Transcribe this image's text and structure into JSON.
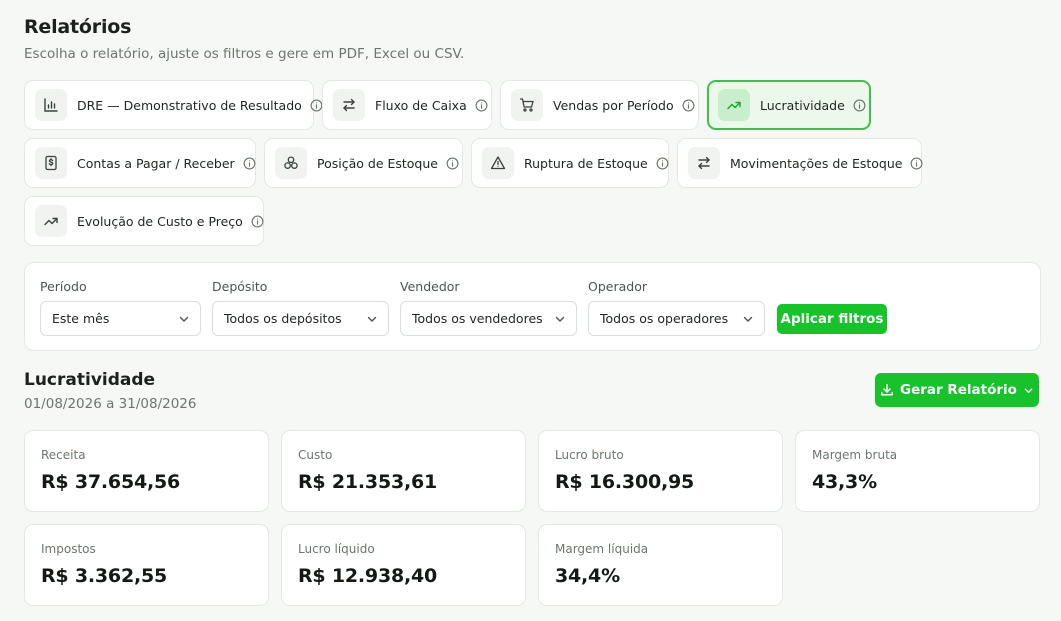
{
  "header": {
    "title": "Relatórios",
    "subtitle": "Escolha o relatório, ajuste os filtros e gere em PDF, Excel ou CSV."
  },
  "reports": [
    {
      "label": "DRE — Demonstrativo de Resultado",
      "icon": "bar-chart-icon"
    },
    {
      "label": "Fluxo de Caixa",
      "icon": "arrows-exchange-icon"
    },
    {
      "label": "Vendas por Período",
      "icon": "shopping-cart-icon"
    },
    {
      "label": "Lucratividade",
      "icon": "trending-up-icon",
      "active": true
    },
    {
      "label": "Contas a Pagar / Receber",
      "icon": "dollar-document-icon"
    },
    {
      "label": "Posição de Estoque",
      "icon": "boxes-icon"
    },
    {
      "label": "Ruptura de Estoque",
      "icon": "warning-triangle-icon"
    },
    {
      "label": "Movimentações de Estoque",
      "icon": "arrows-exchange-icon"
    },
    {
      "label": "Evolução de Custo e Preço",
      "icon": "trending-up-icon"
    }
  ],
  "filters": {
    "period": {
      "label": "Período",
      "value": "Este mês"
    },
    "warehouse": {
      "label": "Depósito",
      "value": "Todos os depósitos"
    },
    "seller": {
      "label": "Vendedor",
      "value": "Todos os vendedores"
    },
    "operator": {
      "label": "Operador",
      "value": "Todos os operadores"
    },
    "apply_label": "Aplicar filtros"
  },
  "result": {
    "title": "Lucratividade",
    "range": "01/08/2026 a 31/08/2026",
    "generate_label": "Gerar Relatório"
  },
  "kpis": [
    {
      "label": "Receita",
      "value": "R$ 37.654,56"
    },
    {
      "label": "Custo",
      "value": "R$ 21.353,61"
    },
    {
      "label": "Lucro bruto",
      "value": "R$ 16.300,95"
    },
    {
      "label": "Margem bruta",
      "value": "43,3%"
    },
    {
      "label": "Impostos",
      "value": "R$ 3.362,55"
    },
    {
      "label": "Lucro líquido",
      "value": "R$ 12.938,40"
    },
    {
      "label": "Margem líquida",
      "value": "34,4%"
    }
  ],
  "colors": {
    "accent": "#17c22a",
    "active_border": "#3fc04a",
    "active_bg": "#ecf8ec"
  }
}
